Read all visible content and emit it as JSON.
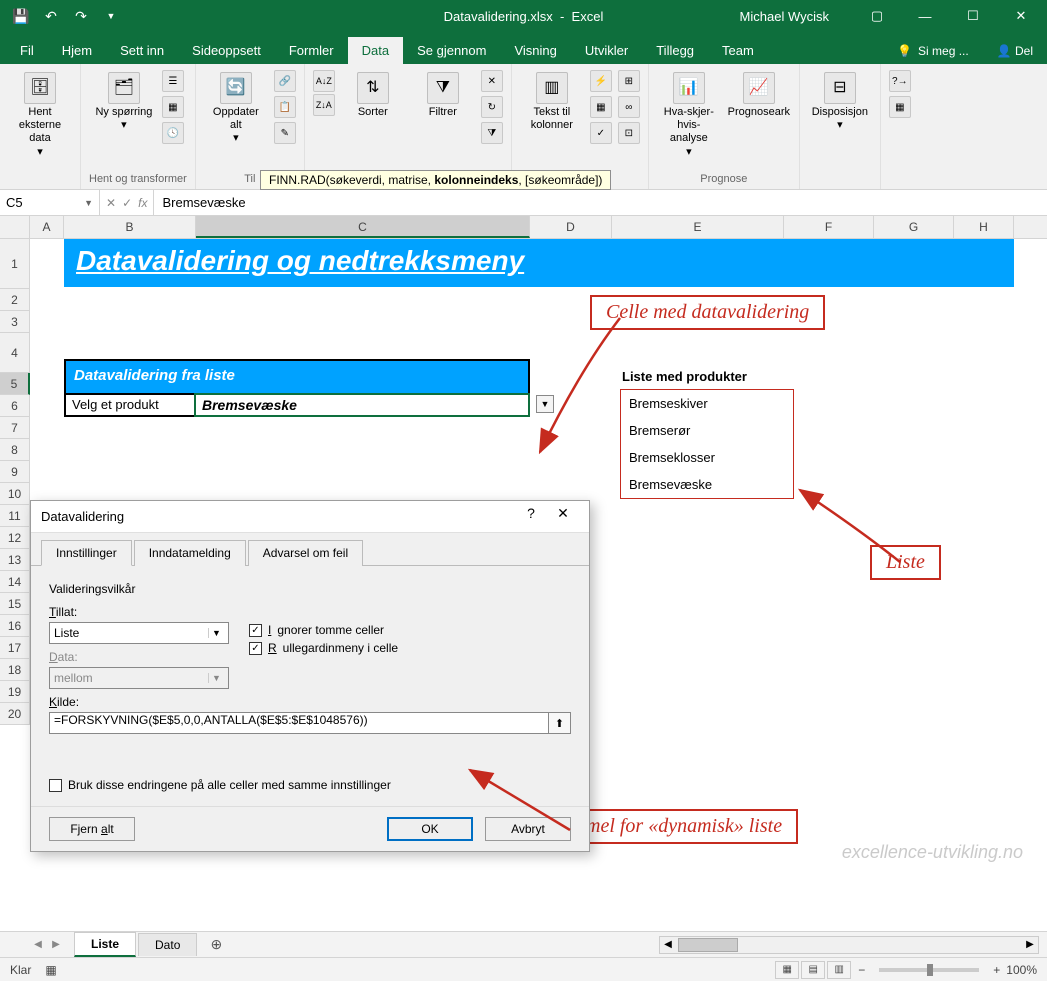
{
  "titlebar": {
    "filename": "Datavalidering.xlsx",
    "app": "Excel",
    "user": "Michael Wycisk"
  },
  "tabs": [
    "Fil",
    "Hjem",
    "Sett inn",
    "Sideoppsett",
    "Formler",
    "Data",
    "Se gjennom",
    "Visning",
    "Utvikler",
    "Tillegg",
    "Team"
  ],
  "active_tab": "Data",
  "tellme": "Si meg ...",
  "share": "Del",
  "ribbon": {
    "hent_eksterne": "Hent eksterne data",
    "ny_sporring": "Ny spørring",
    "oppdater_alt": "Oppdater alt",
    "sorter": "Sorter",
    "filtrer": "Filtrer",
    "tekst_til_kolonner": "Tekst til kolonner",
    "hva_skjer": "Hva-skjer-hvis-analyse",
    "prognoseark": "Prognoseark",
    "disposisjon": "Disposisjon",
    "grp_hent": "Hent og transformer",
    "grp_til": "Til",
    "grp_prognose": "Prognose"
  },
  "tooltip": {
    "prefix": "FINN.RAD(søkeverdi, matrise, ",
    "bold": "kolonneindeks",
    "suffix": ", [søkeområde])"
  },
  "namebox": "C5",
  "formula": "Bremsevæske",
  "cols": [
    "A",
    "B",
    "C",
    "D",
    "E",
    "F",
    "G",
    "H"
  ],
  "rows": [
    "1",
    "2",
    "3",
    "4",
    "5",
    "6",
    "7",
    "8",
    "9",
    "10",
    "11",
    "12",
    "13",
    "14",
    "15",
    "16",
    "17",
    "18",
    "19",
    "20"
  ],
  "sheet": {
    "title": "Datavalidering og nedtrekksmeny",
    "section_header": "Datavalidering fra liste",
    "label": "Velg et produkt",
    "value": "Bremsevæske",
    "list_header": "Liste med produkter",
    "list": [
      "Bremseskiver",
      "Bremserør",
      "Bremseklosser",
      "Bremsevæske"
    ]
  },
  "annotations": {
    "a1": "Celle med datavalidering",
    "a2": "Liste",
    "a3": "Formel for «dynamisk» liste"
  },
  "dialog": {
    "title": "Datavalidering",
    "tabs": [
      "Innstillinger",
      "Inndatamelding",
      "Advarsel om feil"
    ],
    "group_label": "Valideringsvilkår",
    "tillat_label": "Tillat:",
    "tillat_value": "Liste",
    "data_label": "Data:",
    "data_value": "mellom",
    "ignore_blank": "Ignorer tomme celler",
    "in_cell_dropdown": "Rullegardinmeny i celle",
    "kilde_label": "Kilde:",
    "kilde_value": "=FORSKYVNING($E$5,0,0,ANTALLA($E$5:$E$1048576))",
    "apply_all": "Bruk disse endringene på alle celler med samme innstillinger",
    "clear_all": "Fjern alt",
    "ok": "OK",
    "cancel": "Avbryt"
  },
  "sheets": [
    "Liste",
    "Dato"
  ],
  "active_sheet": "Liste",
  "status": {
    "ready": "Klar",
    "zoom": "100%"
  },
  "watermark": "excellence-utvikling.no"
}
